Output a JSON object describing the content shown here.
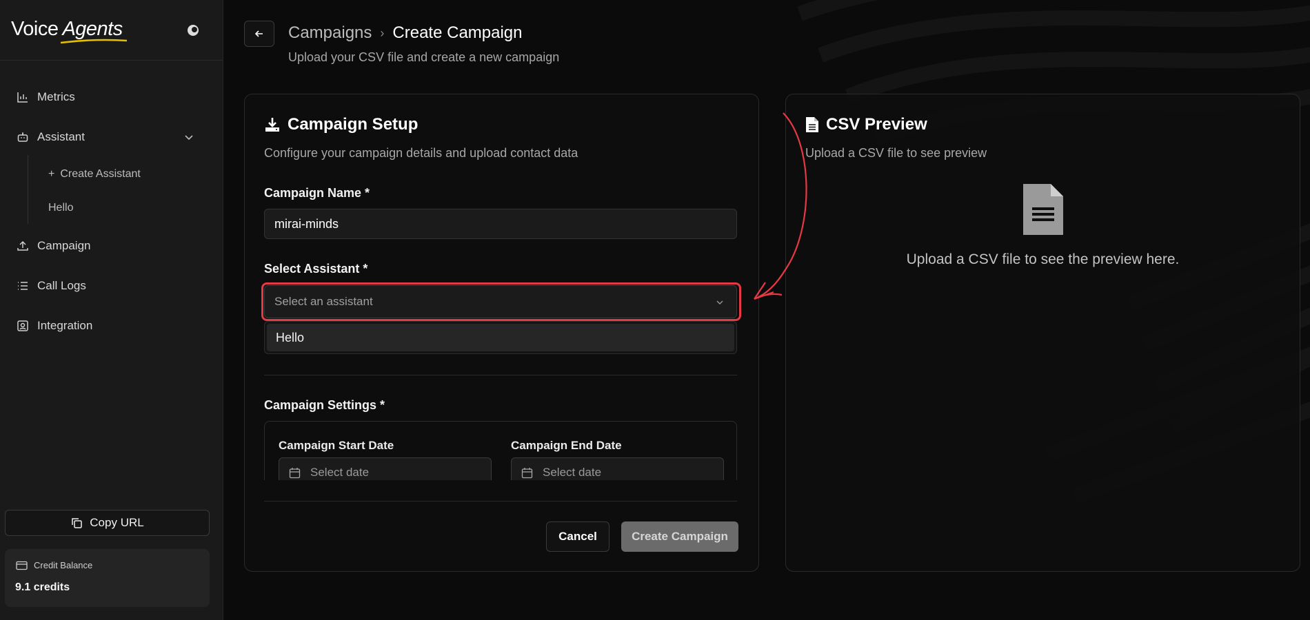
{
  "app": {
    "logo_word1": "Voice",
    "logo_word2": "Agents"
  },
  "sidebar": {
    "items": [
      {
        "label": "Metrics",
        "icon": "bar-chart-icon"
      },
      {
        "label": "Assistant",
        "icon": "bot-icon"
      },
      {
        "label": "Campaign",
        "icon": "upload-icon"
      },
      {
        "label": "Call Logs",
        "icon": "list-icon"
      },
      {
        "label": "Integration",
        "icon": "integration-icon"
      }
    ],
    "sub_items": [
      {
        "label": "Create Assistant",
        "prefix": "+"
      },
      {
        "label": "Hello"
      }
    ],
    "copy_url_label": "Copy URL",
    "credit_label": "Credit Balance",
    "credit_value": "9.1 credits"
  },
  "header": {
    "breadcrumb_parent": "Campaigns",
    "breadcrumb_sep": "›",
    "breadcrumb_current": "Create Campaign",
    "subtitle": "Upload your CSV file and create a new campaign"
  },
  "setup": {
    "title": "Campaign Setup",
    "description": "Configure your campaign details and upload contact data",
    "name_label": "Campaign Name *",
    "name_value": "mirai-minds",
    "assistant_label": "Select Assistant *",
    "assistant_placeholder": "Select an assistant",
    "assistant_options": [
      "Hello"
    ],
    "settings_label": "Campaign Settings *",
    "start_date_label": "Campaign Start Date",
    "start_date_placeholder": "Select date",
    "end_date_label": "Campaign End Date",
    "end_date_placeholder": "Select date",
    "cancel_label": "Cancel",
    "create_label": "Create Campaign"
  },
  "preview": {
    "title": "CSV Preview",
    "description": "Upload a CSV file to see preview",
    "empty_message": "Upload a CSV file to see the preview here."
  },
  "colors": {
    "highlight": "#e63946",
    "accent_underline": "#e5c100"
  }
}
